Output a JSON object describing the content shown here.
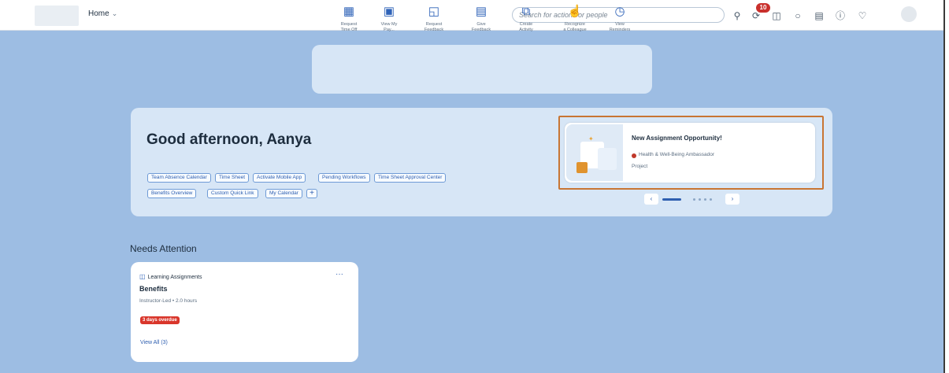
{
  "shell": {
    "home_label": "Home",
    "search_placeholder": "Search for actions or people",
    "notification_count": "10",
    "icons": [
      "search-icon",
      "notification-icon",
      "inbox-icon",
      "headset-icon",
      "clipboard-icon",
      "help-icon",
      "bell-icon"
    ]
  },
  "quick_actions": [
    {
      "label_1": "Request",
      "label_2": "Time Off",
      "icon": "calendar-icon"
    },
    {
      "label_1": "View My",
      "label_2": "Pay...",
      "icon": "pay-icon"
    },
    {
      "label_1": "Request",
      "label_2": "Feedback",
      "icon": "feedback-request-icon"
    },
    {
      "label_1": "Give",
      "label_2": "Feedback",
      "icon": "feedback-give-icon"
    },
    {
      "label_1": "Create",
      "label_2": "Activity",
      "icon": "activity-icon"
    },
    {
      "label_1": "Recognize",
      "label_2": "a Colleague",
      "icon": "thumbs-up-icon"
    },
    {
      "label_1": "View",
      "label_2": "Reminders",
      "icon": "reminder-icon"
    }
  ],
  "greeting": {
    "title": "Good afternoon, Aanya",
    "links_row1": [
      "Team Absence Calendar",
      "Time Sheet",
      "Activate Mobile App",
      "Pending Workflows",
      "Time Sheet Approval Center"
    ],
    "links_row2": [
      "Benefits Overview",
      "Custom Quick Link",
      "My Calendar"
    ],
    "add_label": "+"
  },
  "opportunity": {
    "title": "New Assignment Opportunity!",
    "subtitle": "Health & Well-Being Ambassador",
    "type": "Project",
    "prev": "‹",
    "next": "›"
  },
  "needs_attention": {
    "heading": "Needs Attention",
    "card": {
      "type": "Learning Assignments",
      "more": "···",
      "title": "Benefits",
      "meta": "Instructor-Led • 2.0 hours",
      "badge": "3 days overdue",
      "view_all": "View All (3)"
    }
  },
  "colors": {
    "page_bg": "#9dbde3",
    "card_bg": "#d7e6f6",
    "accent": "#2f5fb0",
    "badge_red": "#d9362b",
    "highlight_border": "#c87533"
  }
}
